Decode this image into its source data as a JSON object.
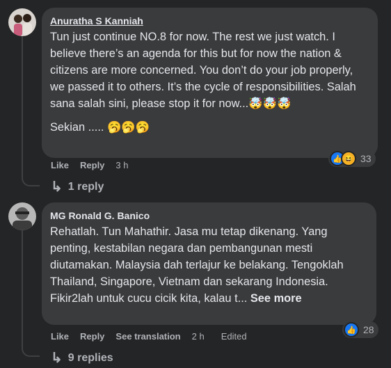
{
  "comments": [
    {
      "author": "Anuratha S Kanniah",
      "text": "Tun just continue NO.8 for now. The rest we just watch. I believe there’s an agenda for this but for now the nation & citizens are more concerned. You don’t do your job properly, we passed it to others. It’s the cycle of responsibilities. Salah sana salah sini, please stop it for now...🤯🤯🤯",
      "text2": "Sekian ..... 🥱🥱🥱",
      "like_label": "Like",
      "reply_label": "Reply",
      "time": "3 h",
      "reaction_count": "33",
      "reactions": [
        "like-icon",
        "haha-icon"
      ],
      "replies_label": "1 reply"
    },
    {
      "author": "MG Ronald G. Banico",
      "text": "Rehatlah. Tun Mahathir. Jasa mu tetap dikenang. Yang penting, kestabilan negara dan pembangunan mesti diutamakan. Malaysia dah terlajur ke belakang. Tengoklah Thailand, Singapore, Vietnam dan sekarang Indonesia. Fikir2lah untuk cucu cicik kita, kalau t...",
      "see_more": "See more",
      "like_label": "Like",
      "reply_label": "Reply",
      "translation_label": "See translation",
      "time": "2 h",
      "edited_label": "Edited",
      "reaction_count": "28",
      "reactions": [
        "like-icon"
      ],
      "replies_label": "9 replies"
    }
  ],
  "colors": {
    "background": "#242526",
    "bubble": "#3a3b3c",
    "text": "#e4e6eb",
    "secondary": "#b0b3b8",
    "like_blue": "#1877f2"
  }
}
